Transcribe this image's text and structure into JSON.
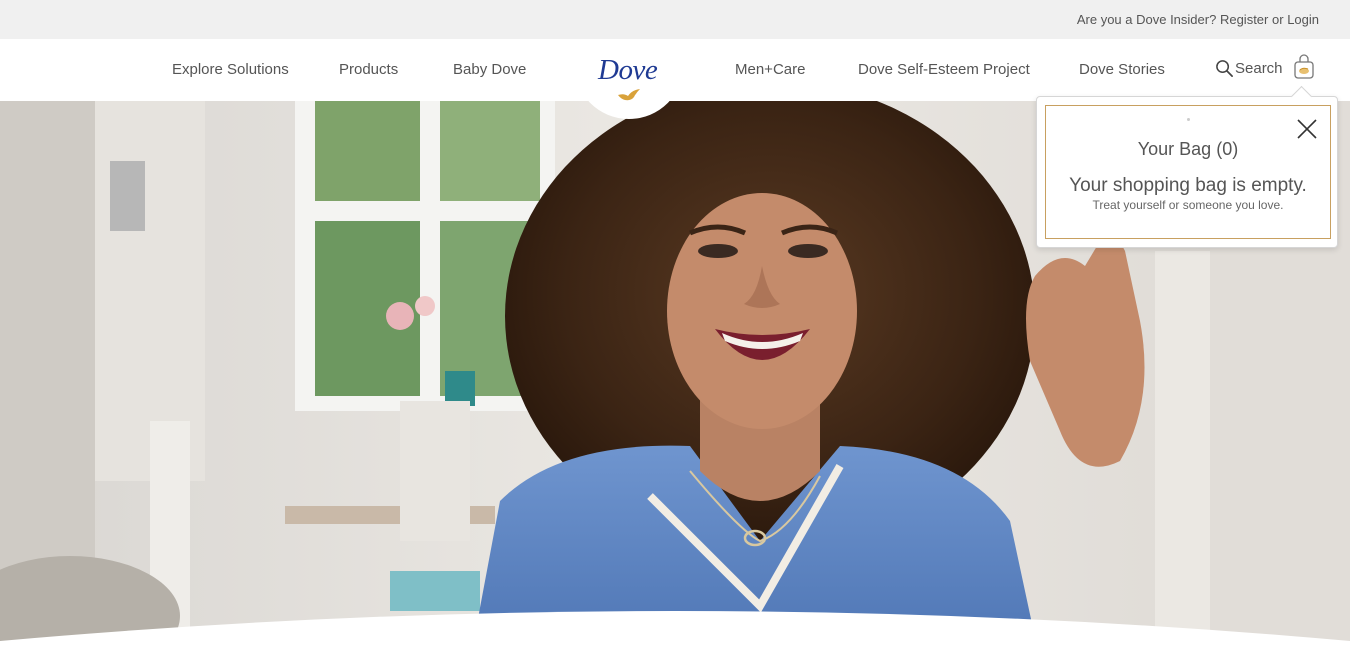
{
  "utility": {
    "question": "Are you a Dove Insider?",
    "register": "Register",
    "or": "or",
    "login": "Login"
  },
  "nav": {
    "items": [
      "Explore Solutions",
      "Products",
      "Baby Dove",
      "Men+Care",
      "Dove Self-Esteem Project",
      "Dove Stories"
    ],
    "search_label": "Search",
    "logo_text": "Dove"
  },
  "bag": {
    "title": "Your Bag (0)",
    "empty_message": "Your shopping bag is empty.",
    "sub_message": "Treat yourself or someone you love."
  },
  "colors": {
    "brand_blue": "#1f3a93",
    "gold_accent": "#c8a060",
    "utility_bg": "#f0f0f0"
  },
  "icons": {
    "search": "search-icon",
    "bag": "shopping-bag-icon",
    "close": "close-icon",
    "logo_bird": "dove-bird-icon"
  }
}
